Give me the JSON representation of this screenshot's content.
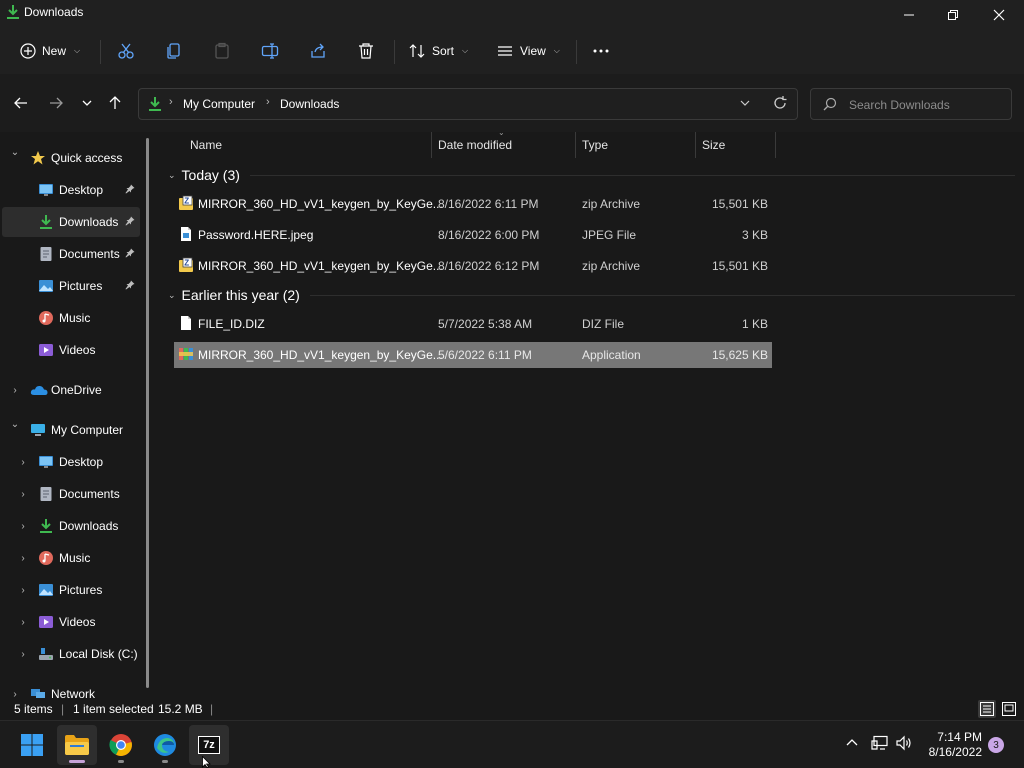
{
  "window": {
    "title": "Downloads"
  },
  "toolbar": {
    "new_label": "New",
    "sort_label": "Sort",
    "view_label": "View"
  },
  "address": {
    "crumbs": [
      "My Computer",
      "Downloads"
    ],
    "search_placeholder": "Search Downloads"
  },
  "sidebar": {
    "quick_access": "Quick access",
    "quick_items": [
      {
        "label": "Desktop",
        "icon": "desktop-icon",
        "pinned": true
      },
      {
        "label": "Downloads",
        "icon": "download-icon",
        "pinned": true,
        "selected": true
      },
      {
        "label": "Documents",
        "icon": "documents-icon",
        "pinned": true
      },
      {
        "label": "Pictures",
        "icon": "pictures-icon",
        "pinned": true
      },
      {
        "label": "Music",
        "icon": "music-icon",
        "pinned": false
      },
      {
        "label": "Videos",
        "icon": "videos-icon",
        "pinned": false
      }
    ],
    "onedrive": "OneDrive",
    "my_computer": "My Computer",
    "computer_items": [
      {
        "label": "Desktop",
        "icon": "desktop-icon"
      },
      {
        "label": "Documents",
        "icon": "documents-icon"
      },
      {
        "label": "Downloads",
        "icon": "download-icon"
      },
      {
        "label": "Music",
        "icon": "music-icon"
      },
      {
        "label": "Pictures",
        "icon": "pictures-icon"
      },
      {
        "label": "Videos",
        "icon": "videos-icon"
      },
      {
        "label": "Local Disk (C:)",
        "icon": "drive-icon"
      }
    ],
    "network": "Network"
  },
  "columns": {
    "name": "Name",
    "date": "Date modified",
    "type": "Type",
    "size": "Size"
  },
  "groups": [
    {
      "title": "Today (3)",
      "files": [
        {
          "name": "MIRROR_360_HD_vV1_keygen_by_KeyGe...",
          "date": "8/16/2022 6:11 PM",
          "type": "zip Archive",
          "size": "15,501 KB",
          "icon": "zip-icon"
        },
        {
          "name": "Password.HERE.jpeg",
          "date": "8/16/2022 6:00 PM",
          "type": "JPEG File",
          "size": "3 KB",
          "icon": "image-file-icon"
        },
        {
          "name": "MIRROR_360_HD_vV1_keygen_by_KeyGe...",
          "date": "8/16/2022 6:12 PM",
          "type": "zip Archive",
          "size": "15,501 KB",
          "icon": "zip-icon"
        }
      ]
    },
    {
      "title": "Earlier this year (2)",
      "files": [
        {
          "name": "FILE_ID.DIZ",
          "date": "5/7/2022 5:38 AM",
          "type": "DIZ File",
          "size": "1 KB",
          "icon": "file-icon"
        },
        {
          "name": "MIRROR_360_HD_vV1_keygen_by_KeyGe...",
          "date": "5/6/2022 6:11 PM",
          "type": "Application",
          "size": "15,625 KB",
          "icon": "app-icon",
          "selected": true
        }
      ]
    }
  ],
  "status": {
    "items": "5 items",
    "selected": "1 item selected",
    "selected_size": "15.2 MB"
  },
  "taskbar": {
    "apps": [
      "start-icon",
      "file-explorer-icon",
      "chrome-icon",
      "edge-icon",
      "7zip-icon"
    ],
    "sevenzip_label": "7z",
    "time": "7:14 PM",
    "date": "8/16/2022",
    "notifications": "3"
  },
  "colors": {
    "accent_download": "#3fb950",
    "folder_yellow": "#f2c94c",
    "selection": "#777777",
    "badge": "#c9a6e6"
  }
}
